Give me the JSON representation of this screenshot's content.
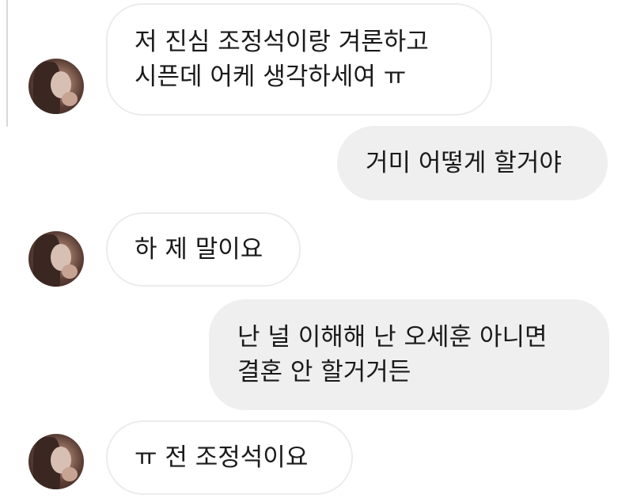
{
  "conversation": {
    "messages": [
      {
        "sender": "other",
        "lines": [
          "저 진심 조정석이랑 겨론하고",
          "시픈데 어케 생각하세여 ㅠ"
        ]
      },
      {
        "sender": "me",
        "lines": [
          "거미 어떻게 할거야"
        ]
      },
      {
        "sender": "other",
        "lines": [
          "하 제 말이요"
        ]
      },
      {
        "sender": "me",
        "lines": [
          "난 널 이해해 난 오세훈 아니면",
          "결혼 안 할거거든"
        ]
      },
      {
        "sender": "other",
        "lines": [
          "ㅠ 전 조정석이요"
        ]
      }
    ]
  },
  "colors": {
    "sent_bubble": "#efefef",
    "received_bubble_border": "#ececec",
    "text": "#1a1a1a"
  },
  "icons": {
    "avatar": "contact-profile-photo"
  }
}
